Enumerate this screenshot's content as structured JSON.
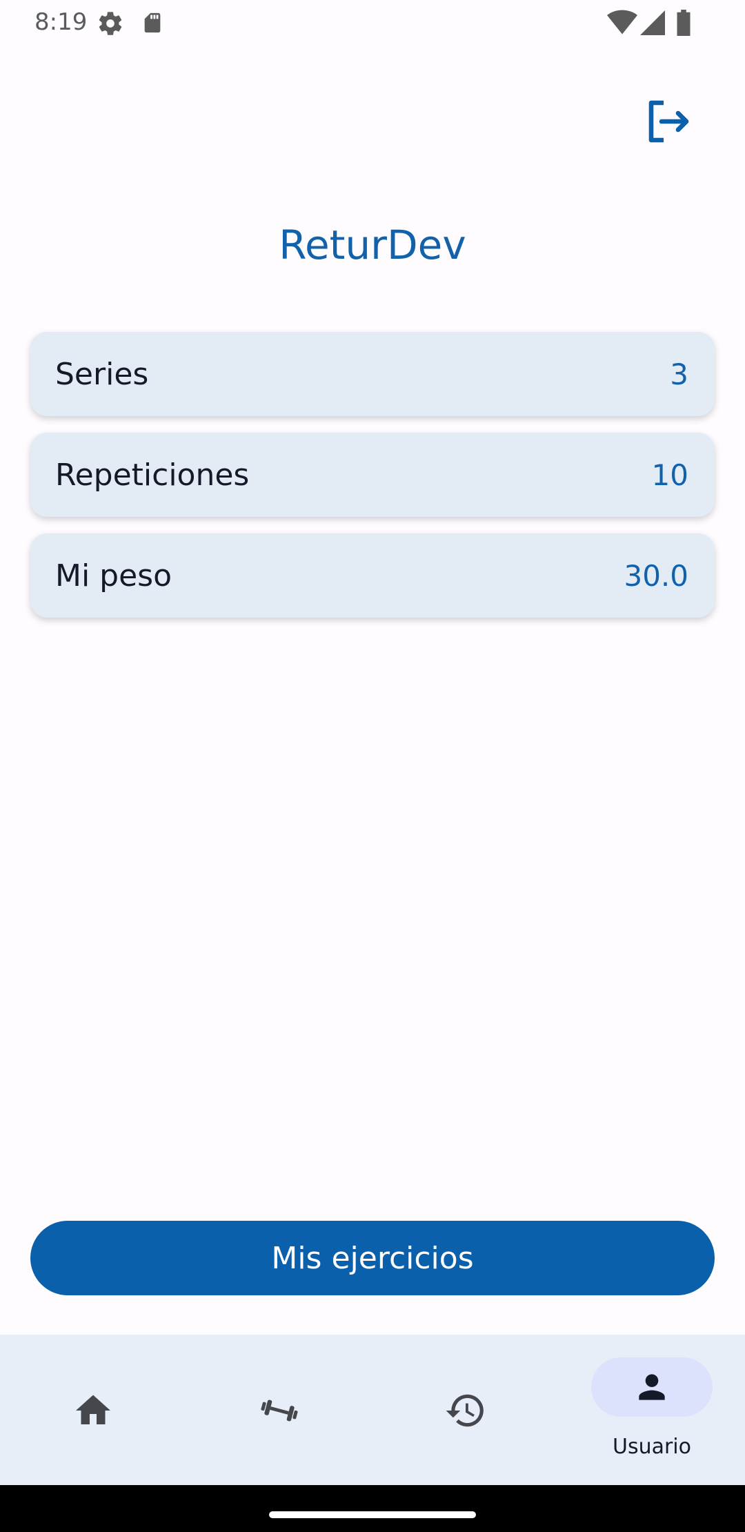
{
  "status_bar": {
    "time": "8:19",
    "icons": [
      "settings-icon",
      "sd-card-icon",
      "wifi-icon",
      "signal-icon",
      "battery-icon"
    ]
  },
  "header": {
    "logout_icon": "logout-icon"
  },
  "app": {
    "title": "ReturDev"
  },
  "stats": [
    {
      "label": "Series",
      "value": "3"
    },
    {
      "label": "Repeticiones",
      "value": "10"
    },
    {
      "label": "Mi peso",
      "value": "30.0"
    }
  ],
  "actions": {
    "primary_label": "Mis ejercicios"
  },
  "bottom_nav": {
    "items": [
      {
        "icon": "home-icon",
        "label": ""
      },
      {
        "icon": "dumbbell-icon",
        "label": ""
      },
      {
        "icon": "history-icon",
        "label": ""
      },
      {
        "icon": "person-icon",
        "label": "Usuario",
        "selected": true
      }
    ]
  },
  "colors": {
    "brand": "#0a60aa",
    "title": "#1262ab",
    "card_bg": "#e3ebf4",
    "nav_bg": "#e8eef7",
    "nav_pill": "#dce2fb",
    "text_dark": "#141a2a"
  }
}
